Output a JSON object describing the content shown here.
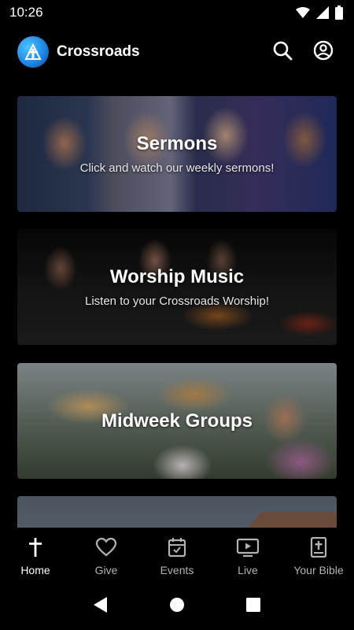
{
  "status_bar": {
    "time": "10:26",
    "icons": [
      "wifi-icon",
      "signal-icon",
      "battery-icon"
    ]
  },
  "header": {
    "title": "Crossroads",
    "logo_icon": "crossroads-logo-icon",
    "actions": [
      "search-icon",
      "account-icon"
    ]
  },
  "cards": [
    {
      "title": "Sermons",
      "subtitle": "Click and watch our weekly sermons!"
    },
    {
      "title": "Worship Music",
      "subtitle": "Listen to your Crossroads Worship!"
    },
    {
      "title": "Midweek Groups",
      "subtitle": ""
    },
    {
      "title": "",
      "subtitle": ""
    }
  ],
  "bottom_nav": {
    "active": "Home",
    "items": [
      {
        "label": "Home",
        "icon": "cross-icon"
      },
      {
        "label": "Give",
        "icon": "heart-icon"
      },
      {
        "label": "Events",
        "icon": "calendar-icon"
      },
      {
        "label": "Live",
        "icon": "live-tv-icon"
      },
      {
        "label": "Your Bible",
        "icon": "bible-icon"
      }
    ]
  },
  "colors": {
    "background": "#000000",
    "active_nav": "#ffffff",
    "inactive_nav": "#b3b3b3",
    "logo_blue": "#1e88e5"
  }
}
